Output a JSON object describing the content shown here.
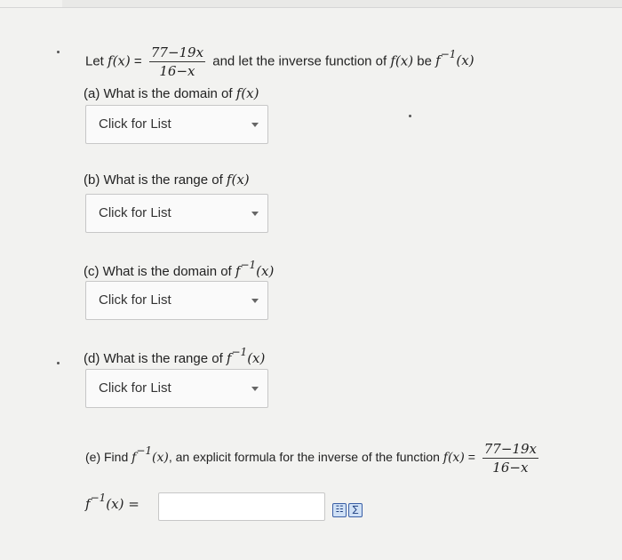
{
  "intro": {
    "let_text": "Let",
    "f_x": "f(x)",
    "equals": "=",
    "numerator": "77−19x",
    "denominator": "16−x",
    "mid_text": "and let the inverse function of",
    "be_text": "be",
    "f_inv_f": "f",
    "f_inv_sup": "−1",
    "f_inv_arg": "(x)"
  },
  "questions": [
    {
      "label": "(a) What is the domain of",
      "math": "f(x)",
      "dropdown_value": "Click for List"
    },
    {
      "label": "(b) What is the range of",
      "math": "f(x)",
      "dropdown_value": "Click for List"
    },
    {
      "label": "(c) What is the domain of",
      "math_f": "f",
      "math_sup": "−1",
      "math_arg": "(x)",
      "dropdown_value": "Click for List"
    },
    {
      "label": "(d) What is the range of",
      "math_f": "f",
      "math_sup": "−1",
      "math_arg": "(x)",
      "dropdown_value": "Click for List"
    }
  ],
  "part_e": {
    "label_start": "(e) Find",
    "math_f": "f",
    "math_sup": "−1",
    "math_arg": "(x)",
    "label_mid": ", an explicit formula for the inverse of the function",
    "f_x": "f(x)",
    "equals": "=",
    "numerator": "77−19x",
    "denominator": "16−x"
  },
  "answer": {
    "lhs_f": "f",
    "lhs_sup": "−1",
    "lhs_arg": "(x)",
    "equals": "=",
    "input_value": ""
  },
  "tools": {
    "preview_icon": "preview-icon",
    "equation_icon": "equation-editor-icon",
    "preview_glyph": "☷",
    "equation_glyph": "∑"
  }
}
